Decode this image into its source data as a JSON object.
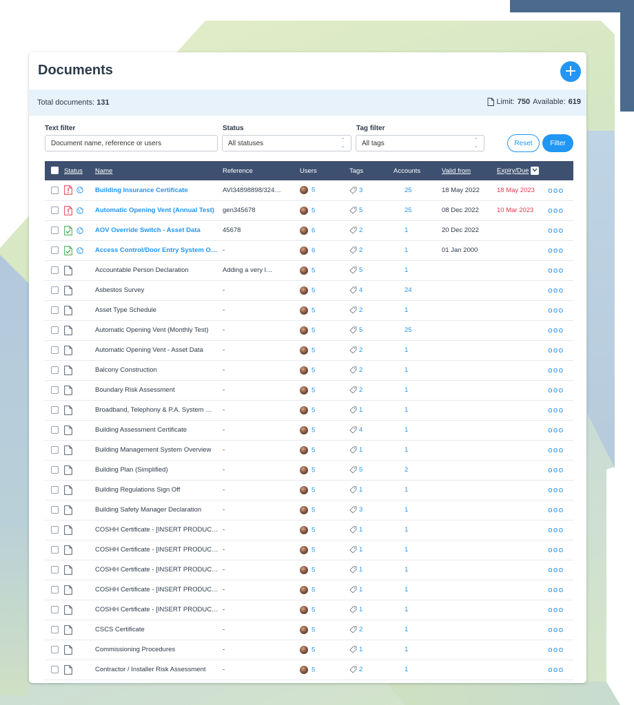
{
  "page": {
    "title": "Documents",
    "add_icon": "plus-icon",
    "summary": {
      "total_label": "Total documents:",
      "total_value": "131",
      "limit_label": "Limit:",
      "limit_value": "750",
      "available_label": "Available:",
      "available_value": "619"
    }
  },
  "filters": {
    "text_label": "Text filter",
    "text_placeholder": "Document name, reference or users",
    "status_label": "Status",
    "status_value": "All statuses",
    "tag_label": "Tag filter",
    "tag_value": "All tags",
    "reset_label": "Reset",
    "filter_label": "Filter"
  },
  "table": {
    "headers": {
      "status": "Status",
      "name": "Name",
      "reference": "Reference",
      "users": "Users",
      "tags": "Tags",
      "accounts": "Accounts",
      "valid_from": "Valid from",
      "expiry": "Expiry/Due"
    },
    "rows": [
      {
        "icon": "expired",
        "globe": true,
        "highlight": true,
        "name": "Building Insurance Certificate",
        "reference": "AVI34898898/324…",
        "users": "5",
        "tags": "3",
        "accounts": "25",
        "valid_from": "18 May 2022",
        "expiry": "18 May 2023",
        "expired": true
      },
      {
        "icon": "expired",
        "globe": true,
        "highlight": true,
        "name": "Automatic Opening Vent (Annual Test)",
        "reference": "gen345678",
        "users": "5",
        "tags": "5",
        "accounts": "25",
        "valid_from": "08 Dec 2022",
        "expiry": "10 Mar 2023",
        "expired": true
      },
      {
        "icon": "valid",
        "globe": true,
        "highlight": true,
        "name": "AOV Override Switch - Asset Data",
        "reference": "45678",
        "users": "6",
        "tags": "2",
        "accounts": "1",
        "valid_from": "20 Dec 2022",
        "expiry": "",
        "expired": false
      },
      {
        "icon": "valid",
        "globe": true,
        "highlight": true,
        "name": "Access Control/Door Entry System O…",
        "reference": "-",
        "users": "6",
        "tags": "2",
        "accounts": "1",
        "valid_from": "01 Jan 2000",
        "expiry": "",
        "expired": false
      },
      {
        "icon": "plain",
        "globe": false,
        "highlight": false,
        "name": "Accountable Person Declaration",
        "reference": "Adding a very l…",
        "users": "5",
        "tags": "5",
        "accounts": "1",
        "valid_from": "",
        "expiry": "",
        "expired": false
      },
      {
        "icon": "plain",
        "globe": false,
        "highlight": false,
        "name": "Asbestos Survey",
        "reference": "-",
        "users": "5",
        "tags": "4",
        "accounts": "24",
        "valid_from": "",
        "expiry": "",
        "expired": false
      },
      {
        "icon": "plain",
        "globe": false,
        "highlight": false,
        "name": "Asset Type Schedule",
        "reference": "-",
        "users": "5",
        "tags": "2",
        "accounts": "1",
        "valid_from": "",
        "expiry": "",
        "expired": false
      },
      {
        "icon": "plain",
        "globe": false,
        "highlight": false,
        "name": "Automatic Opening Vent (Monthly Test)",
        "reference": "-",
        "users": "5",
        "tags": "5",
        "accounts": "25",
        "valid_from": "",
        "expiry": "",
        "expired": false
      },
      {
        "icon": "plain",
        "globe": false,
        "highlight": false,
        "name": "Automatic Opening Vent - Asset Data",
        "reference": "-",
        "users": "5",
        "tags": "2",
        "accounts": "1",
        "valid_from": "",
        "expiry": "",
        "expired": false
      },
      {
        "icon": "plain",
        "globe": false,
        "highlight": false,
        "name": "Balcony Construction",
        "reference": "-",
        "users": "5",
        "tags": "2",
        "accounts": "1",
        "valid_from": "",
        "expiry": "",
        "expired": false
      },
      {
        "icon": "plain",
        "globe": false,
        "highlight": false,
        "name": "Boundary Risk Assessment",
        "reference": "-",
        "users": "5",
        "tags": "2",
        "accounts": "1",
        "valid_from": "",
        "expiry": "",
        "expired": false
      },
      {
        "icon": "plain",
        "globe": false,
        "highlight": false,
        "name": "Broadband, Telephony & P.A. System …",
        "reference": "-",
        "users": "5",
        "tags": "1",
        "accounts": "1",
        "valid_from": "",
        "expiry": "",
        "expired": false
      },
      {
        "icon": "plain",
        "globe": false,
        "highlight": false,
        "name": "Building Assessment Certificate",
        "reference": "-",
        "users": "5",
        "tags": "4",
        "accounts": "1",
        "valid_from": "",
        "expiry": "",
        "expired": false
      },
      {
        "icon": "plain",
        "globe": false,
        "highlight": false,
        "name": "Building Management System Overview",
        "reference": "-",
        "users": "5",
        "tags": "1",
        "accounts": "1",
        "valid_from": "",
        "expiry": "",
        "expired": false
      },
      {
        "icon": "plain",
        "globe": false,
        "highlight": false,
        "name": "Building Plan (Simplified)",
        "reference": "-",
        "users": "5",
        "tags": "5",
        "accounts": "2",
        "valid_from": "",
        "expiry": "",
        "expired": false
      },
      {
        "icon": "plain",
        "globe": false,
        "highlight": false,
        "name": "Building Regulations Sign Off",
        "reference": "-",
        "users": "5",
        "tags": "1",
        "accounts": "1",
        "valid_from": "",
        "expiry": "",
        "expired": false
      },
      {
        "icon": "plain",
        "globe": false,
        "highlight": false,
        "name": "Building Safety Manager Declaration",
        "reference": "-",
        "users": "5",
        "tags": "3",
        "accounts": "1",
        "valid_from": "",
        "expiry": "",
        "expired": false
      },
      {
        "icon": "plain",
        "globe": false,
        "highlight": false,
        "name": "COSHH Certificate - [INSERT PRODUC…",
        "reference": "-",
        "users": "5",
        "tags": "1",
        "accounts": "1",
        "valid_from": "",
        "expiry": "",
        "expired": false
      },
      {
        "icon": "plain",
        "globe": false,
        "highlight": false,
        "name": "COSHH Certificate - [INSERT PRODUC…",
        "reference": "-",
        "users": "5",
        "tags": "1",
        "accounts": "1",
        "valid_from": "",
        "expiry": "",
        "expired": false
      },
      {
        "icon": "plain",
        "globe": false,
        "highlight": false,
        "name": "COSHH Certificate - [INSERT PRODUC…",
        "reference": "-",
        "users": "5",
        "tags": "1",
        "accounts": "1",
        "valid_from": "",
        "expiry": "",
        "expired": false
      },
      {
        "icon": "plain",
        "globe": false,
        "highlight": false,
        "name": "COSHH Certificate - [INSERT PRODUC…",
        "reference": "-",
        "users": "5",
        "tags": "1",
        "accounts": "1",
        "valid_from": "",
        "expiry": "",
        "expired": false
      },
      {
        "icon": "plain",
        "globe": false,
        "highlight": false,
        "name": "COSHH Certificate - [INSERT PRODUC…",
        "reference": "-",
        "users": "5",
        "tags": "1",
        "accounts": "1",
        "valid_from": "",
        "expiry": "",
        "expired": false
      },
      {
        "icon": "plain",
        "globe": false,
        "highlight": false,
        "name": "CSCS Certificate",
        "reference": "-",
        "users": "5",
        "tags": "2",
        "accounts": "1",
        "valid_from": "",
        "expiry": "",
        "expired": false
      },
      {
        "icon": "plain",
        "globe": false,
        "highlight": false,
        "name": "Commissioning Procedures",
        "reference": "-",
        "users": "5",
        "tags": "1",
        "accounts": "1",
        "valid_from": "",
        "expiry": "",
        "expired": false
      },
      {
        "icon": "plain",
        "globe": false,
        "highlight": false,
        "name": "Contractor / Installer Risk Assessment",
        "reference": "-",
        "users": "5",
        "tags": "2",
        "accounts": "1",
        "valid_from": "",
        "expiry": "",
        "expired": false
      }
    ]
  },
  "colors": {
    "accent": "#2196f3",
    "header_bg": "#3d5070",
    "expired": "#e53950",
    "valid": "#3aa845",
    "summary_bg": "#e8f2fb"
  }
}
